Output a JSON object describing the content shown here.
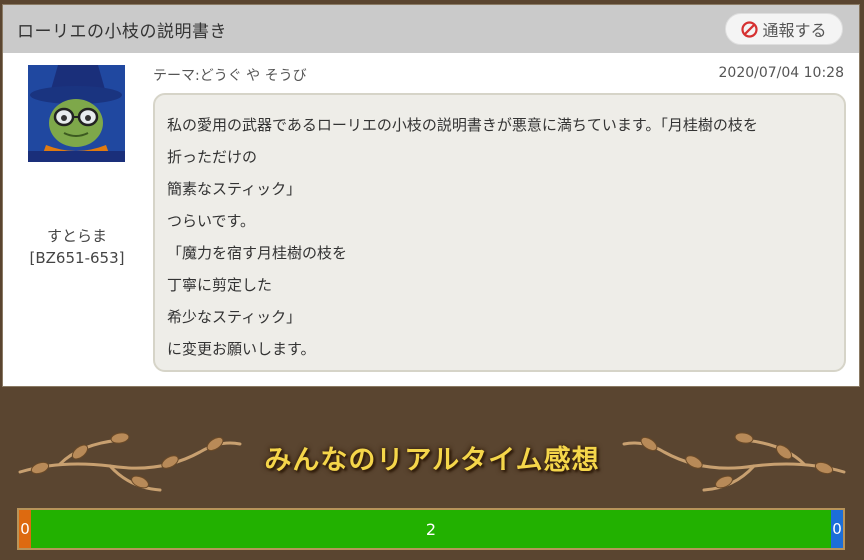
{
  "post": {
    "title": "ローリエの小枝の説明書き",
    "report_label": "通報する",
    "author_name": "すとらま",
    "author_id": "[BZ651-653]",
    "theme": "テーマ:どうぐ や そうび",
    "date": "2020/07/04 10:28",
    "lines": [
      "私の愛用の武器であるローリエの小枝の説明書きが悪意に満ちています。「月桂樹の枝を",
      "折っただけの",
      "簡素なスティック」",
      "つらいです。",
      "「魔力を宿す月桂樹の枝を",
      "丁寧に剪定した",
      "希少なスティック」",
      "に変更お願いします。"
    ]
  },
  "reactions": {
    "banner_title": "みんなのリアルタイム感想",
    "left_count": "0",
    "middle_count": "2",
    "right_count": "0"
  },
  "colors": {
    "left_bar": "#dd6a10",
    "middle_bar": "#22b100",
    "right_bar": "#1c6ed8",
    "banner_text": "#f5d64a"
  },
  "icons": {
    "report": "no-entry-icon"
  }
}
